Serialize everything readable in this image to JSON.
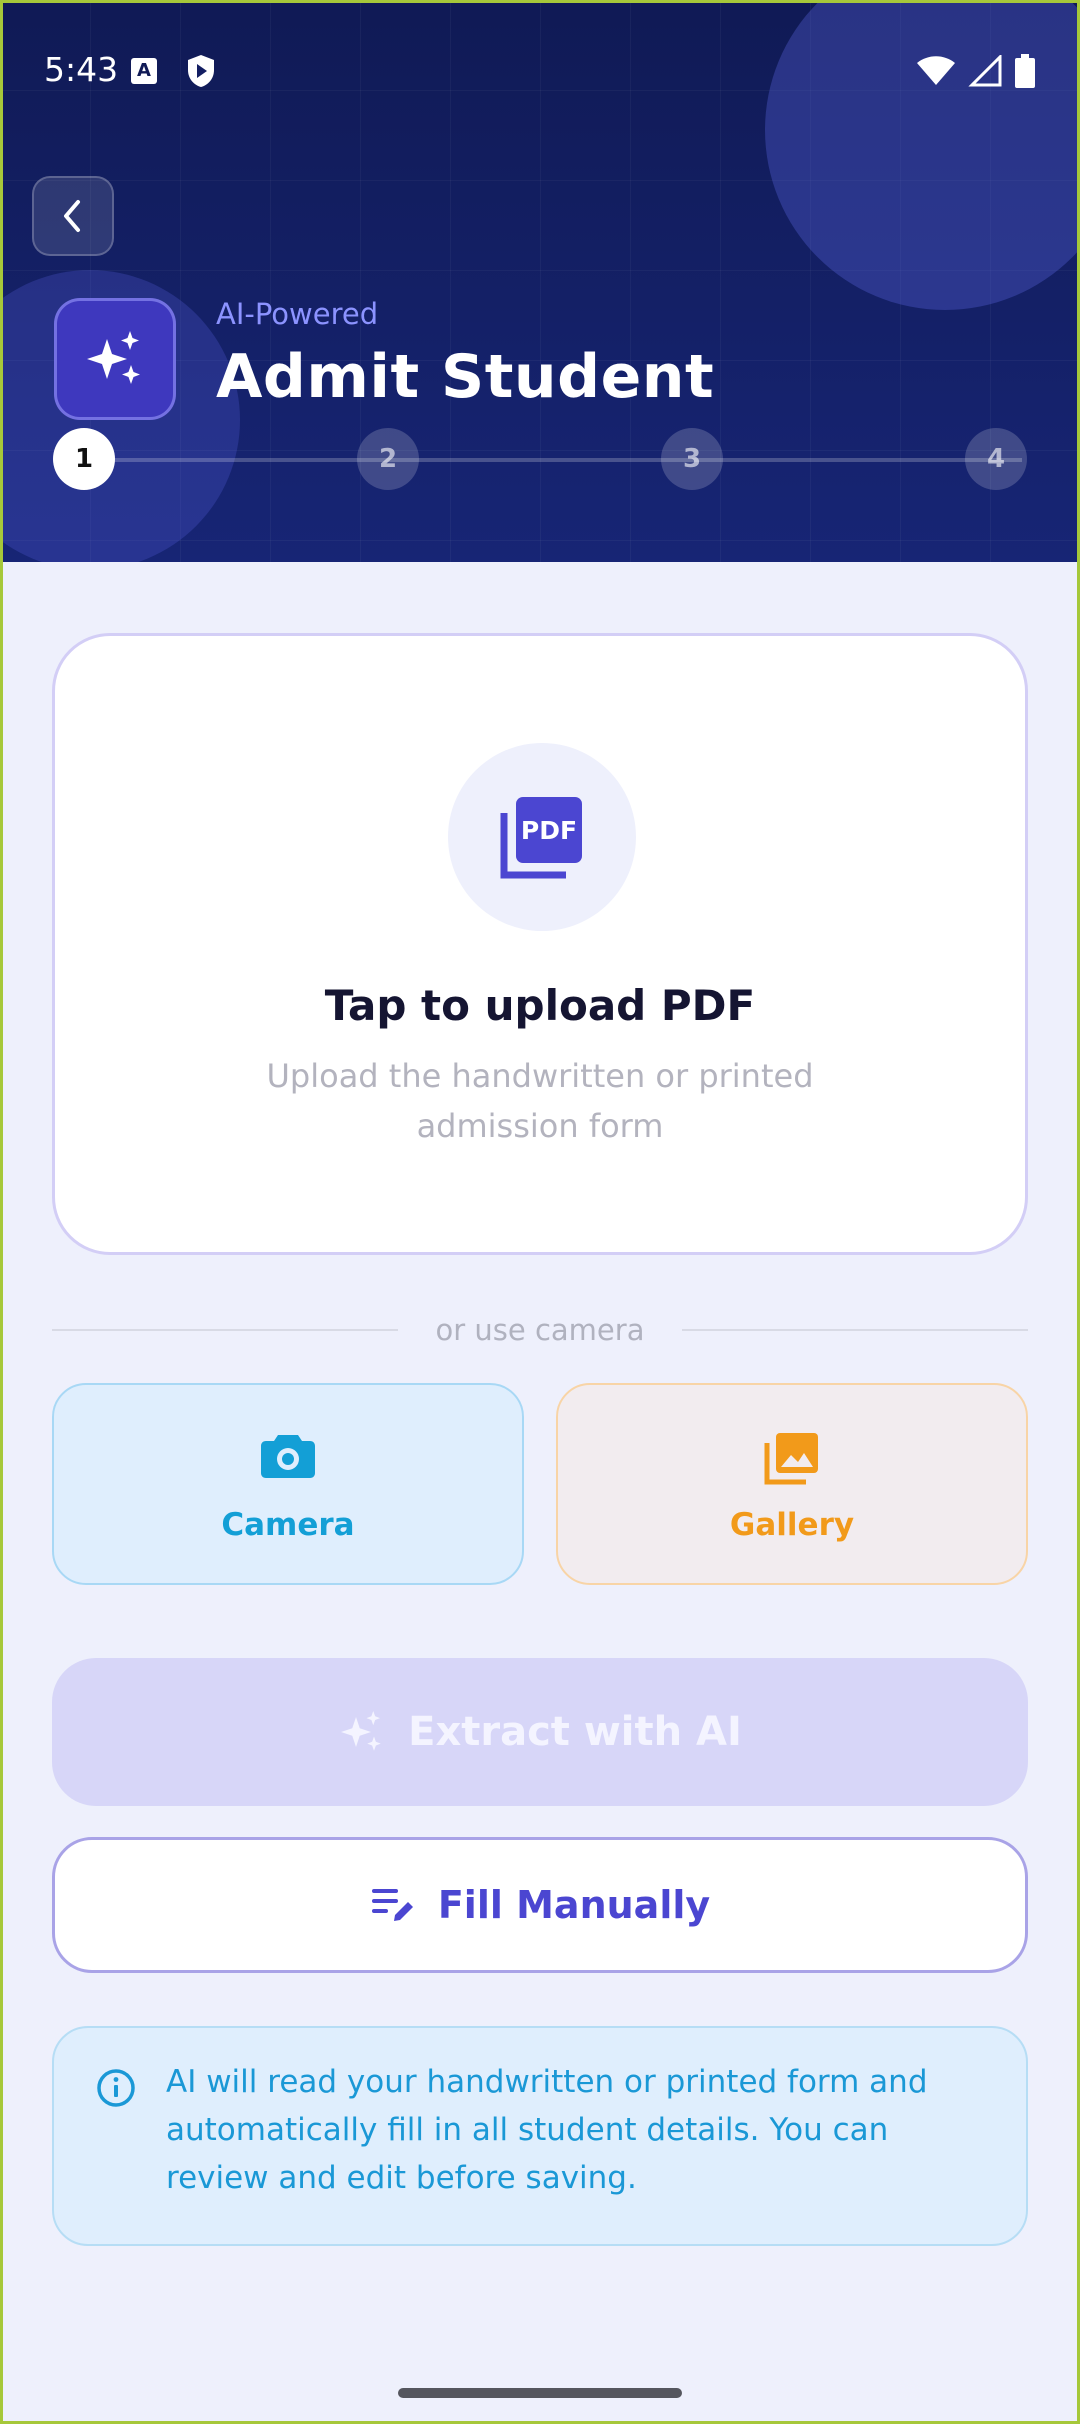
{
  "status_bar": {
    "time": "5:43",
    "icons": [
      "a-notification-icon",
      "shield-play-icon",
      "wifi-icon",
      "signal-icon",
      "battery-icon"
    ]
  },
  "header": {
    "back_icon": "chevron-left-icon",
    "hero_icon": "sparkles-icon",
    "overline": "AI-Powered",
    "title": "Admit Student",
    "steps": [
      "1",
      "2",
      "3",
      "4"
    ],
    "active_step": 1
  },
  "upload": {
    "icon": "pdf-icon",
    "title": "Tap to upload PDF",
    "subtitle": "Upload the handwritten or printed admission form"
  },
  "divider_text": "or use camera",
  "media": {
    "camera_label": "Camera",
    "gallery_label": "Gallery"
  },
  "actions": {
    "extract_label": "Extract with AI",
    "fill_label": "Fill Manually"
  },
  "info": {
    "text": "AI will read your handwritten or printed form and automatically fill in all student details. You can review and edit before saving."
  },
  "colors": {
    "header_bg": "#131E62",
    "accent": "#4B46D1",
    "camera": "#139FD6",
    "gallery": "#F29A1A",
    "info_text": "#1A98D6"
  }
}
